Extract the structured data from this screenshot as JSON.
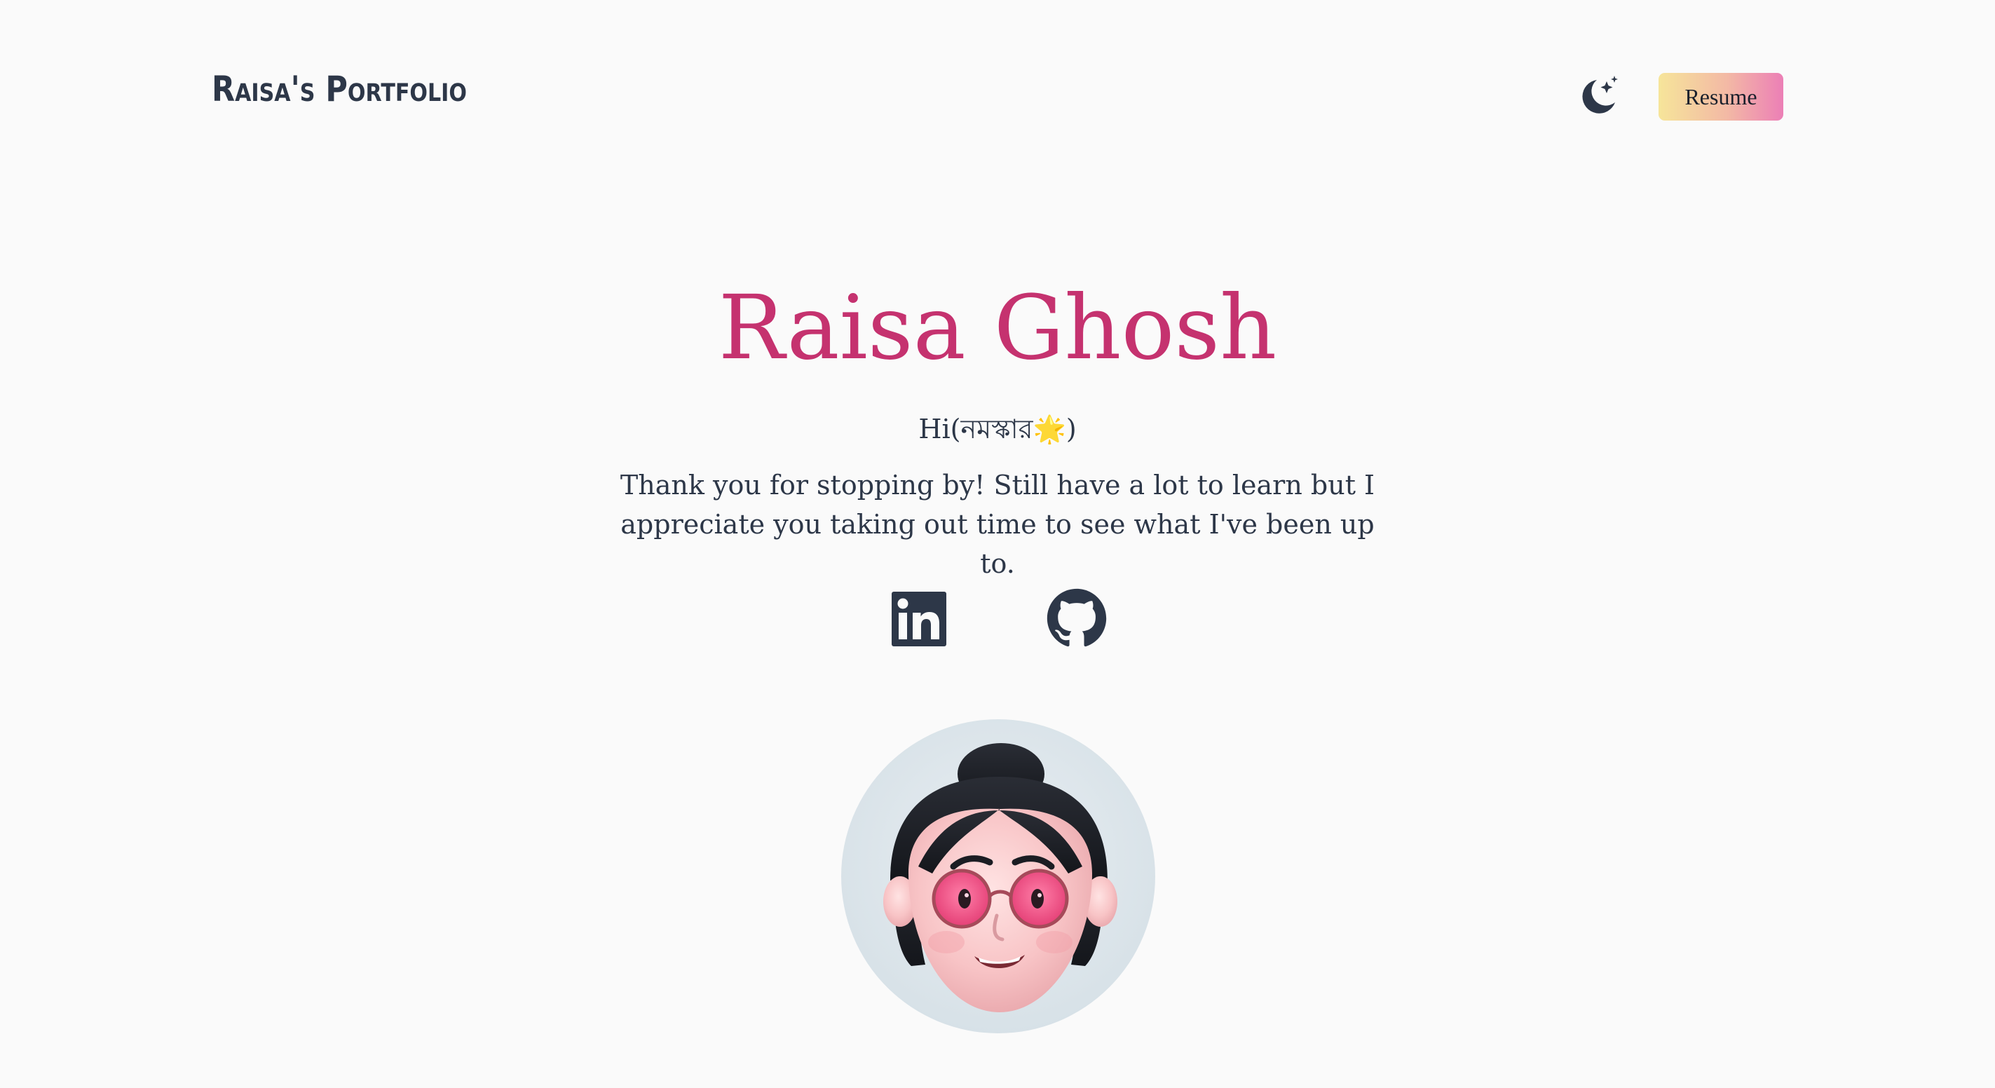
{
  "navbar": {
    "brand": "Raisa's Portfolio",
    "theme_toggle_icon": "moon-stars-icon",
    "resume_label": "Resume"
  },
  "hero": {
    "name": "Raisa Ghosh",
    "greeting": "Hi(নমস্কার🌟)",
    "intro": "Thank you for stopping by! Still have a lot to learn but I appreciate you taking out time to see what I've been up to."
  },
  "social": [
    {
      "icon": "linkedin-icon"
    },
    {
      "icon": "github-icon"
    }
  ],
  "avatar": {
    "icon": "memoji-avatar"
  },
  "colors": {
    "background": "#fafafa",
    "accent": "#c5326f",
    "text": "#2d3748",
    "resume_gradient_start": "#f6e59a",
    "resume_gradient_end": "#ec7fb6"
  }
}
